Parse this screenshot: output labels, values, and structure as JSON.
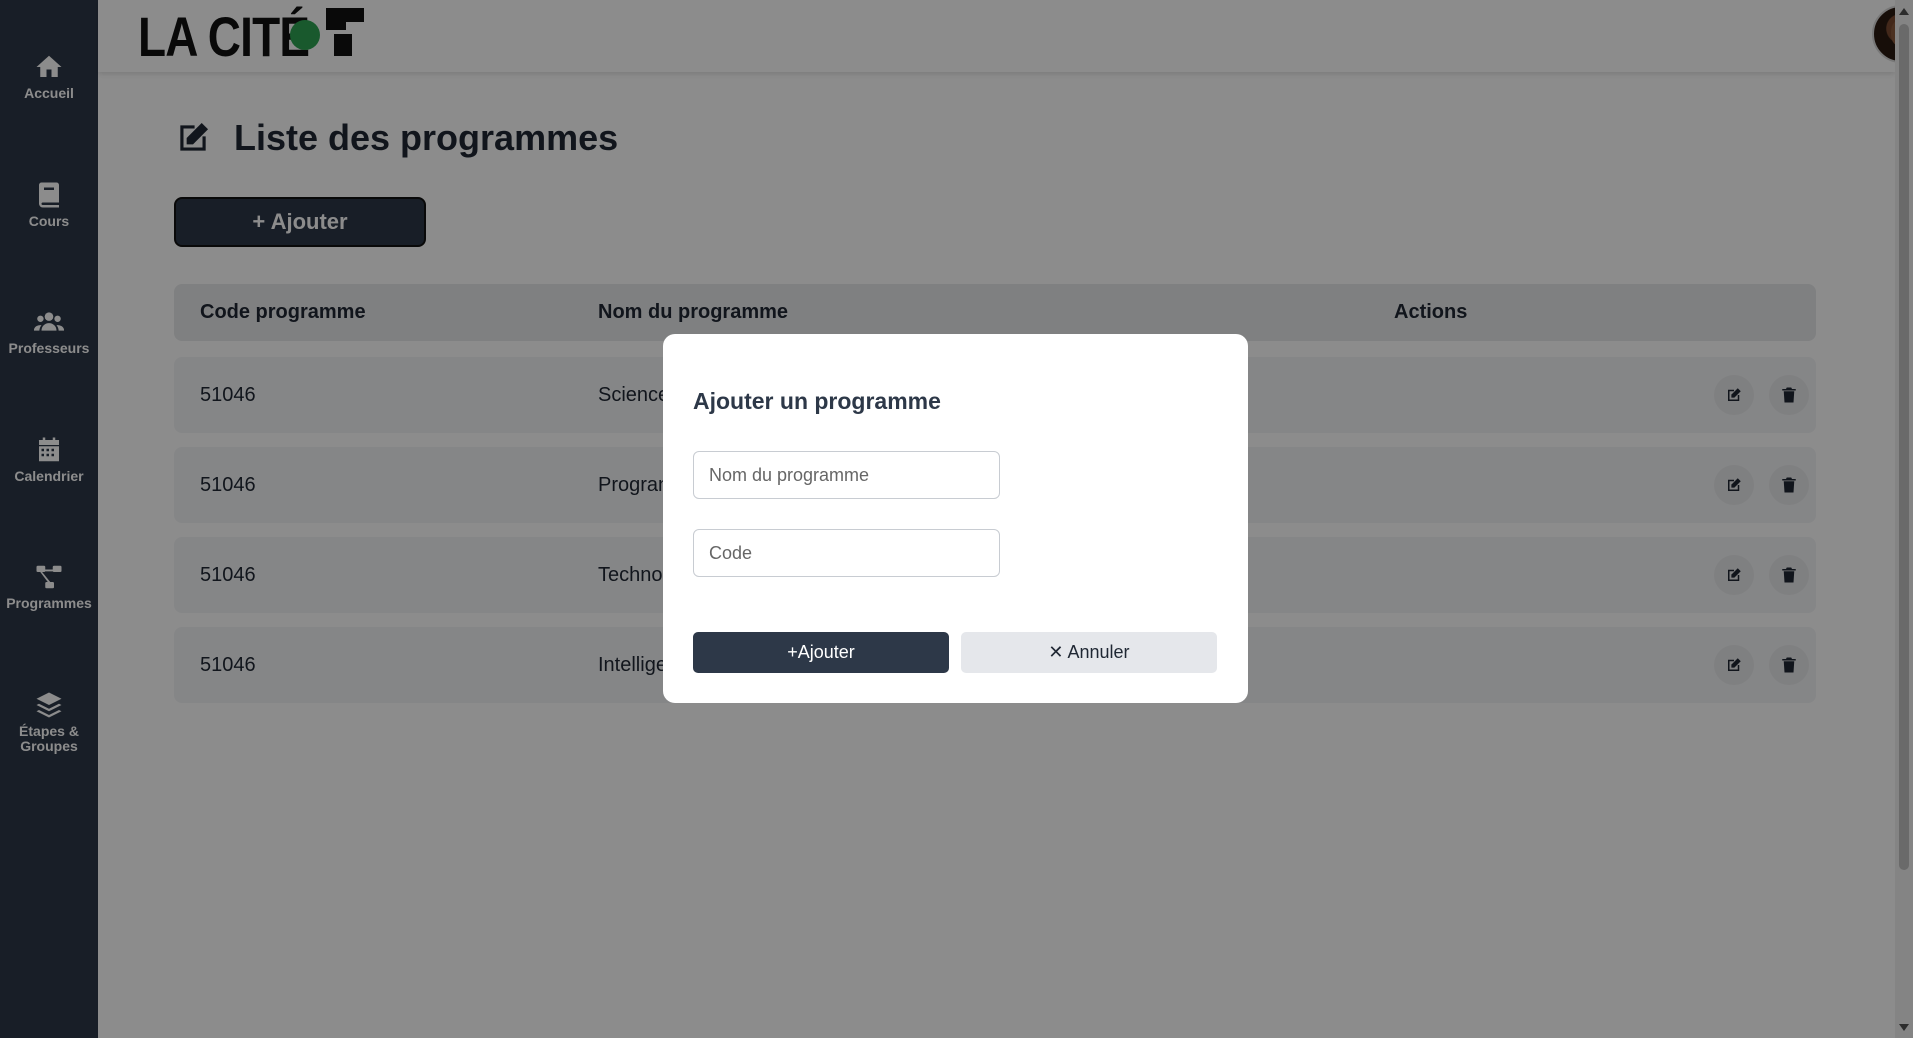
{
  "sidebar": {
    "items": [
      {
        "label": "Accueil",
        "icon": "home-icon"
      },
      {
        "label": "Cours",
        "icon": "book-icon"
      },
      {
        "label": "Professeurs",
        "icon": "users-icon"
      },
      {
        "label": "Calendrier",
        "icon": "calendar-icon"
      },
      {
        "label": "Programmes",
        "icon": "sitemap-icon"
      },
      {
        "label": "Étapes & Groupes",
        "icon": "layers-icon"
      }
    ]
  },
  "header": {
    "logo_text": "LA CITÉ",
    "avatar_menu_icon": "caret-down-icon"
  },
  "main": {
    "page_title": "Liste des programmes",
    "title_icon": "edit-icon",
    "add_button_label": "+ Ajouter",
    "table": {
      "columns": [
        "Code programme",
        "Nom du programme",
        "Actions"
      ],
      "rows": [
        {
          "code": "51046",
          "name": "Science"
        },
        {
          "code": "51046",
          "name": "Progran"
        },
        {
          "code": "51046",
          "name": "Technol"
        },
        {
          "code": "51046",
          "name": "Intellige"
        }
      ]
    }
  },
  "modal": {
    "title": "Ajouter un programme",
    "name_placeholder": "Nom du programme",
    "code_placeholder": "Code",
    "submit_label": "+Ajouter",
    "cancel_label": "✕ Annuler"
  },
  "colors": {
    "sidebar": "#2d3848",
    "accent_green": "#2ea352",
    "overlay": "rgba(0,0,0,0.45)"
  }
}
